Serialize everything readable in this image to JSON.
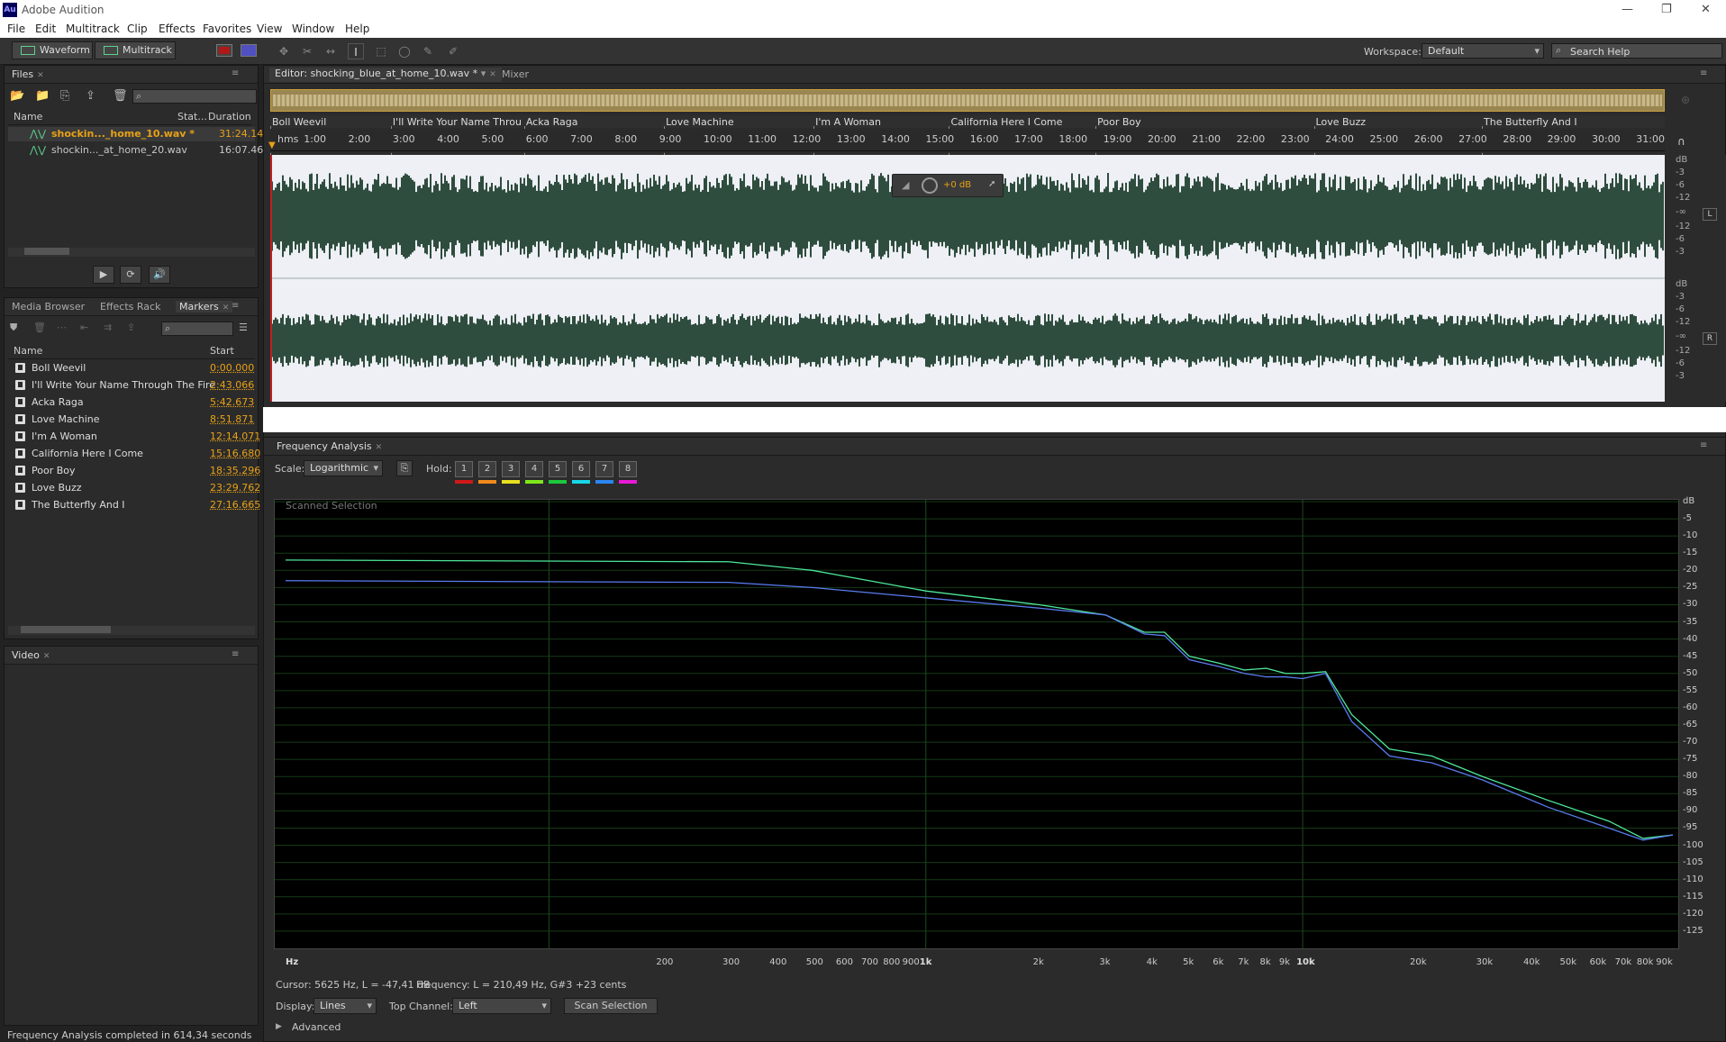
{
  "app": {
    "title": "Adobe Audition",
    "logo": "Au"
  },
  "menu": [
    "File",
    "Edit",
    "Multitrack",
    "Clip",
    "Effects",
    "Favorites",
    "View",
    "Window",
    "Help"
  ],
  "toolbar": {
    "waveform_label": "Waveform",
    "multitrack_label": "Multitrack",
    "workspace_label": "Workspace:",
    "workspace_value": "Default",
    "search_placeholder": "Search Help"
  },
  "files_panel": {
    "tab": "Files",
    "columns": [
      "Name",
      "Stat...",
      "Duration"
    ],
    "rows": [
      {
        "name": "shockin..._home_10.wav *",
        "duration": "31:24.14"
      },
      {
        "name": "shockin..._at_home_20.wav",
        "duration": "16:07.464"
      }
    ]
  },
  "lower_tabs": {
    "media_browser": "Media Browser",
    "effects_rack": "Effects Rack",
    "markers": "Markers"
  },
  "markers_panel": {
    "columns": [
      "Name",
      "Start"
    ],
    "rows": [
      {
        "name": "Boll Weevil",
        "start": "0:00.000"
      },
      {
        "name": "I'll Write Your Name Through The Fire",
        "start": "2:43.066"
      },
      {
        "name": "Acka Raga",
        "start": "5:42.673"
      },
      {
        "name": "Love Machine",
        "start": "8:51.871"
      },
      {
        "name": "I'm A Woman",
        "start": "12:14.071"
      },
      {
        "name": "California Here I Come",
        "start": "15:16.680"
      },
      {
        "name": "Poor Boy",
        "start": "18:35.296"
      },
      {
        "name": "Love Buzz",
        "start": "23:29.762"
      },
      {
        "name": "The Butterfly And I",
        "start": "27:16.665"
      }
    ]
  },
  "video_panel": {
    "tab": "Video"
  },
  "editor": {
    "tab": "Editor: shocking_blue_at_home_10.wav *",
    "mixer_tab": "Mixer",
    "marker_labels": [
      {
        "label": "Boll Weevil",
        "t": 0
      },
      {
        "label": "I'll Write Your Name Throug",
        "t": 163
      },
      {
        "label": "Acka Raga",
        "t": 343
      },
      {
        "label": "Love Machine",
        "t": 532
      },
      {
        "label": "I'm A Woman",
        "t": 734
      },
      {
        "label": "California Here I Come",
        "t": 917
      },
      {
        "label": "Poor Boy",
        "t": 1115
      },
      {
        "label": "Love Buzz",
        "t": 1410
      },
      {
        "label": "The Butterfly And I",
        "t": 1637
      }
    ],
    "time_ticks": [
      "hms",
      "1:00",
      "2:00",
      "3:00",
      "4:00",
      "5:00",
      "6:00",
      "7:00",
      "8:00",
      "9:00",
      "10:00",
      "11:00",
      "12:00",
      "13:00",
      "14:00",
      "15:00",
      "16:00",
      "17:00",
      "18:00",
      "19:00",
      "20:00",
      "21:00",
      "22:00",
      "23:00",
      "24:00",
      "25:00",
      "26:00",
      "27:00",
      "28:00",
      "29:00",
      "30:00",
      "31:00"
    ],
    "db_ticks": [
      "dB",
      "-3",
      "-6",
      "-12",
      "-∞",
      "-12",
      "-6",
      "-3"
    ],
    "channel_left": "L",
    "channel_right": "R",
    "hud_value": "+0 dB"
  },
  "freq_panel": {
    "tab": "Frequency Analysis",
    "scale_label": "Scale:",
    "scale_value": "Logarithmic",
    "hold_label": "Hold:",
    "holds": [
      {
        "n": "1",
        "color": "#d01818"
      },
      {
        "n": "2",
        "color": "#f08a1c"
      },
      {
        "n": "3",
        "color": "#e8e020"
      },
      {
        "n": "4",
        "color": "#7ee81a"
      },
      {
        "n": "5",
        "color": "#1cc83c"
      },
      {
        "n": "6",
        "color": "#19d6e8"
      },
      {
        "n": "7",
        "color": "#2b86f0"
      },
      {
        "n": "8",
        "color": "#e81ad6"
      }
    ],
    "graph_title": "Scanned Selection",
    "freq_ticks": [
      {
        "label": "Hz",
        "f": 20
      },
      {
        "label": "200",
        "f": 200
      },
      {
        "label": "300",
        "f": 300
      },
      {
        "label": "400",
        "f": 400
      },
      {
        "label": "500",
        "f": 500
      },
      {
        "label": "600",
        "f": 600
      },
      {
        "label": "700",
        "f": 700
      },
      {
        "label": "800",
        "f": 800
      },
      {
        "label": "900",
        "f": 900
      },
      {
        "label": "1k",
        "f": 1000
      },
      {
        "label": "2k",
        "f": 2000
      },
      {
        "label": "3k",
        "f": 3000
      },
      {
        "label": "4k",
        "f": 4000
      },
      {
        "label": "5k",
        "f": 5000
      },
      {
        "label": "6k",
        "f": 6000
      },
      {
        "label": "7k",
        "f": 7000
      },
      {
        "label": "8k",
        "f": 8000
      },
      {
        "label": "9k",
        "f": 9000
      },
      {
        "label": "10k",
        "f": 10000
      },
      {
        "label": "20k",
        "f": 20000
      },
      {
        "label": "30k",
        "f": 30000
      },
      {
        "label": "40k",
        "f": 40000
      },
      {
        "label": "50k",
        "f": 50000
      },
      {
        "label": "60k",
        "f": 60000
      },
      {
        "label": "70k",
        "f": 70000
      },
      {
        "label": "80k",
        "f": 80000
      },
      {
        "label": "90k",
        "f": 90000
      }
    ],
    "db_ticks": [
      "dB",
      "-5",
      "-10",
      "-15",
      "-20",
      "-25",
      "-30",
      "-35",
      "-40",
      "-45",
      "-50",
      "-55",
      "-60",
      "-65",
      "-70",
      "-75",
      "-80",
      "-85",
      "-90",
      "-95",
      "-100",
      "-105",
      "-110",
      "-115",
      "-120",
      "-125"
    ],
    "cursor_text": "Cursor: 5625 Hz, L = -47,41 dB",
    "frequency_text": "Frequency: L = 210,49 Hz, G#3 +23 cents",
    "display_label": "Display:",
    "display_value": "Lines",
    "top_channel_label": "Top Channel:",
    "top_channel_value": "Left",
    "scan_button": "Scan Selection",
    "advanced_label": "Advanced"
  },
  "chart_data": {
    "type": "line",
    "title": "Scanned Selection",
    "xscale": "log",
    "xlim": [
      20,
      96000
    ],
    "ylim": [
      -130,
      0
    ],
    "grid": true,
    "series": [
      {
        "color": "#4ee89a",
        "x": [
          20,
          300,
          500,
          1000,
          2000,
          3000,
          3800,
          4300,
          5000,
          6000,
          7000,
          8000,
          9000,
          10000,
          11500,
          13500,
          17000,
          22000,
          30000,
          45000,
          65000,
          80000,
          96000
        ],
        "y": [
          -17,
          -17.5,
          -20,
          -26,
          -30,
          -33,
          -38,
          -38,
          -45,
          -47,
          -49,
          -48.5,
          -50,
          -50,
          -49.5,
          -62,
          -72,
          -74,
          -80,
          -87,
          -93,
          -98,
          -97
        ]
      },
      {
        "color": "#5a7cf0",
        "x": [
          20,
          300,
          500,
          1000,
          2000,
          3000,
          3800,
          4300,
          5000,
          6000,
          7000,
          8000,
          9000,
          10000,
          11500,
          13500,
          17000,
          22000,
          30000,
          45000,
          65000,
          80000,
          96000
        ],
        "y": [
          -23,
          -23.5,
          -25,
          -28,
          -31,
          -33,
          -38.5,
          -39,
          -46,
          -48,
          -50,
          -51,
          -51,
          -51.5,
          -50,
          -64,
          -74,
          -76,
          -81,
          -89,
          -95,
          -98.5,
          -97
        ]
      }
    ]
  },
  "status": "Frequency Analysis completed in 614,34 seconds"
}
